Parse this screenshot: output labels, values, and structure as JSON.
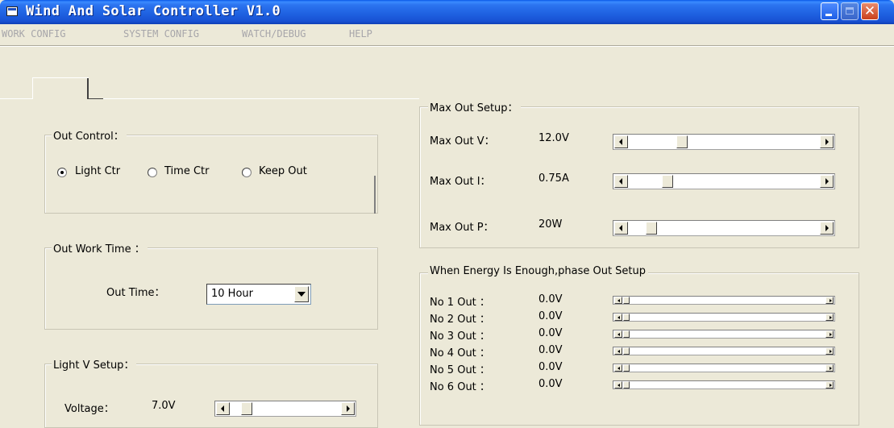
{
  "window": {
    "title": "Wind And Solar Controller V1.0"
  },
  "menu": [
    "WORK CONFIG",
    "SYSTEM CONFIG",
    "WATCH/DEBUG",
    "HELP"
  ],
  "out_control": {
    "legend": "Out Control：",
    "options": [
      {
        "label": "Light Ctr",
        "selected": true
      },
      {
        "label": "Time Ctr",
        "selected": false
      },
      {
        "label": "Keep Out",
        "selected": false
      }
    ]
  },
  "out_work_time": {
    "legend": "Out Work Time ：",
    "label": "Out Time：",
    "value": "10 Hour"
  },
  "light_v_setup": {
    "legend": "Light V Setup：",
    "label": "Voltage：",
    "value": "7.0V",
    "slider_fraction": 0.12
  },
  "max_out_setup": {
    "legend": "Max Out Setup：",
    "rows": [
      {
        "label": "Max Out V：",
        "value": "12.0V",
        "slider_fraction": 0.34
      },
      {
        "label": "Max Out I：",
        "value": "0.75A",
        "slider_fraction": 0.24
      },
      {
        "label": "Max Out P：",
        "value": "20W",
        "slider_fraction": 0.14
      }
    ]
  },
  "phase_out_setup": {
    "legend": "When Energy Is Enough,phase Out Setup",
    "rows": [
      {
        "label": "No 1 Out ：",
        "value": "0.0V",
        "slider_fraction": 0
      },
      {
        "label": "No 2 Out ：",
        "value": "0.0V",
        "slider_fraction": 0
      },
      {
        "label": "No 3 Out ：",
        "value": "0.0V",
        "slider_fraction": 0
      },
      {
        "label": "No 4 Out ：",
        "value": "0.0V",
        "slider_fraction": 0
      },
      {
        "label": "No 5 Out ：",
        "value": "0.0V",
        "slider_fraction": 0
      },
      {
        "label": "No 6 Out ：",
        "value": "0.0V",
        "slider_fraction": 0
      }
    ]
  },
  "colors": {
    "titlebar": "#1E60E0",
    "window_bg": "#ECE9D8",
    "menu_text_disabled": "#A7A6AA"
  }
}
